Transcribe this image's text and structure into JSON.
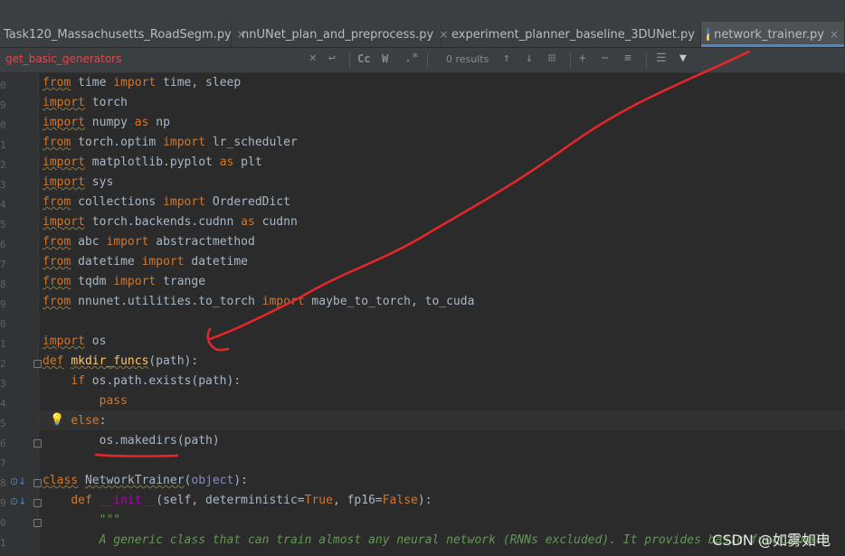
{
  "tabs": [
    {
      "label": "Task120_Massachusetts_RoadSegm.py",
      "close": "×",
      "active": false
    },
    {
      "label": "nnUNet_plan_and_preprocess.py",
      "close": "×",
      "active": false
    },
    {
      "label": "experiment_planner_baseline_3DUNet.py",
      "close": "×",
      "active": false
    },
    {
      "label": "network_trainer.py",
      "close": "×",
      "active": true
    }
  ],
  "search": {
    "query": "get_basic_generators",
    "clear_icon": "×",
    "history_icon": "↩",
    "match_case": "Cc",
    "words": "W",
    "regex": ".*",
    "results": "0 results",
    "prev_icon": "↑",
    "next_icon": "↓",
    "select_all_icon": "⊡",
    "filter_icon": "▼"
  },
  "code": {
    "line1": {
      "k1": "from",
      "t1": " time ",
      "k2": "import",
      "t2": " time, sleep"
    },
    "line2": {
      "k1": "import",
      "t1": " torch"
    },
    "line3": {
      "k1": "import",
      "t1": " numpy ",
      "k2": "as",
      "t2": " np"
    },
    "line4": {
      "k1": "from",
      "t1": " torch.optim ",
      "k2": "import",
      "t2": " lr_scheduler"
    },
    "line5": {
      "k1": "import",
      "t1": " matplotlib.pyplot ",
      "k2": "as",
      "t2": " plt"
    },
    "line6": {
      "k1": "import",
      "t1": " sys"
    },
    "line7": {
      "k1": "from",
      "t1": " collections ",
      "k2": "import",
      "t2": " OrderedDict"
    },
    "line8": {
      "k1": "import",
      "t1": " torch.backends.cudnn ",
      "k2": "as",
      "t2": " cudnn"
    },
    "line9": {
      "k1": "from",
      "t1": " abc ",
      "k2": "import",
      "t2": " abstractmethod"
    },
    "line10": {
      "k1": "from",
      "t1": " datetime ",
      "k2": "import",
      "t2": " datetime"
    },
    "line11": {
      "k1": "from",
      "t1": " tqdm ",
      "k2": "import",
      "t2": " trange"
    },
    "line12": {
      "k1": "from",
      "t1": " nnunet.utilities.to_torch ",
      "k2": "import",
      "t2": " maybe_to_torch, to_cuda"
    },
    "line14": {
      "k1": "import",
      "t1": " os"
    },
    "line15": {
      "k1": "def",
      "t1": " ",
      "fn": "mkdir_funcs",
      "t2": "(path):"
    },
    "line16": {
      "indent": "    ",
      "k1": "if",
      "t1": " os.path.exists(path):"
    },
    "line17": {
      "indent": "        ",
      "k1": "pass"
    },
    "line18": {
      "indent": "    ",
      "k1": "else",
      "t1": ":"
    },
    "line19": {
      "indent": "        ",
      "t1": "os.makedirs(path)"
    },
    "line21": {
      "k1": "class",
      "t1": " ",
      "fn": "NetworkTrainer",
      "t2": "(",
      "bi": "object",
      "t3": "):"
    },
    "line22": {
      "indent": "    ",
      "k1": "def",
      "t1": " ",
      "fn": "__init__",
      "t2": "(self, deterministic=",
      "k2": "True",
      "t3": ", fp16=",
      "k3": "False",
      "t4": "):"
    },
    "line23": {
      "indent": "        ",
      "doc": "\"\"\""
    },
    "line24": {
      "indent": "        ",
      "doc": "A generic class that can train almost any neural network (RNNs excluded). It provides basic functionali"
    }
  },
  "watermark": "CSDN @如雾如电",
  "colors": {
    "keyword": "#cc7832",
    "function": "#ffc66d",
    "text": "#a9b7c6",
    "annotation": "#e8262a",
    "accent": "#4a88c7"
  }
}
